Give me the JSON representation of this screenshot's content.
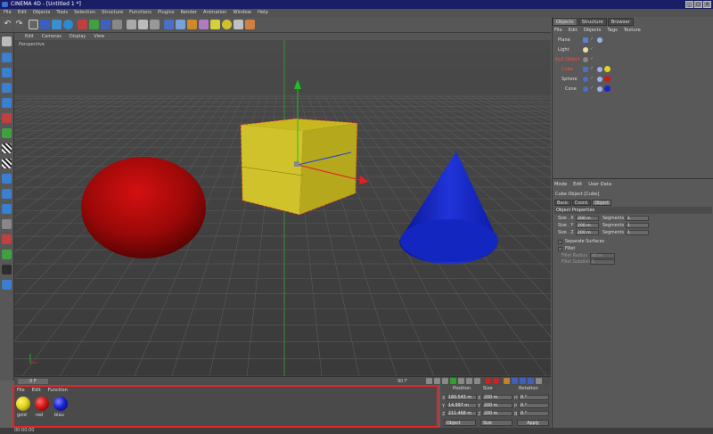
{
  "window": {
    "title": "CINEMA 4D - [Untitled 1 *]",
    "buttons": [
      "_",
      "□",
      "×"
    ]
  },
  "menu": [
    "File",
    "Edit",
    "Objects",
    "Tools",
    "Selection",
    "Structure",
    "Functions",
    "Plugins",
    "Render",
    "Animation",
    "Window",
    "Help"
  ],
  "viewport": {
    "menu": [
      "Edit",
      "Cameras",
      "Display",
      "View"
    ],
    "label": "Perspective",
    "objects": [
      {
        "name": "Sphere",
        "color": "#c81010"
      },
      {
        "name": "Cube",
        "color": "#d6c62a"
      },
      {
        "name": "Cone",
        "color": "#1a2fc8"
      }
    ]
  },
  "timeline": {
    "frame": "0 F",
    "end_frame": "90 F"
  },
  "material_manager": {
    "menu": [
      "File",
      "Edit",
      "Function"
    ],
    "materials": [
      {
        "name": "gold",
        "color": "#e3d21e"
      },
      {
        "name": "red",
        "color": "#d01818"
      },
      {
        "name": "blau",
        "color": "#1824d0"
      }
    ],
    "highlight_color": "#e8222a"
  },
  "coordinates": {
    "headers": {
      "position": "Position",
      "size": "Size",
      "rotation": "Rotation"
    },
    "rows": [
      {
        "axis": "X",
        "position": "180.543 m",
        "size": "200 m",
        "rot_axis": "H",
        "rotation": "0 °"
      },
      {
        "axis": "Y",
        "position": "14.997 m",
        "size": "200 m",
        "rot_axis": "P",
        "rotation": "0 °"
      },
      {
        "axis": "Z",
        "position": "211.468 m",
        "size": "200 m",
        "rot_axis": "B",
        "rotation": "0 °"
      }
    ],
    "dropdown_left": "Object",
    "dropdown_mid": "Size",
    "apply_label": "Apply"
  },
  "status": {
    "text": "00:00:00"
  },
  "objects_panel": {
    "tabs": [
      "Objects",
      "Structure",
      "Browser"
    ],
    "menu": [
      "File",
      "Edit",
      "Objects",
      "Tags",
      "Texture"
    ],
    "items": [
      {
        "name": "Plane",
        "indent": 0,
        "selected": false,
        "material_color": null
      },
      {
        "name": "Light",
        "indent": 0,
        "selected": false,
        "material_color": null
      },
      {
        "name": "Null Object",
        "indent": 0,
        "selected": true,
        "material_color": null
      },
      {
        "name": "Cube",
        "indent": 1,
        "selected": true,
        "material_color": "#e3d21e"
      },
      {
        "name": "Sphere",
        "indent": 1,
        "selected": false,
        "material_color": "#d01818"
      },
      {
        "name": "Cone",
        "indent": 1,
        "selected": false,
        "material_color": "#1824d0"
      }
    ]
  },
  "attributes": {
    "menu": [
      "Mode",
      "Edit",
      "User Data"
    ],
    "title": "Cube Object [Cube]",
    "tabs": [
      "Basic",
      "Coord.",
      "Object"
    ],
    "active_tab": "Object",
    "section_header": "Object Properties",
    "size_rows": [
      {
        "label": "Size . X",
        "value": "200 m",
        "seg_label": "Segments X",
        "seg_value": "1"
      },
      {
        "label": "Size . Y",
        "value": "200 m",
        "seg_label": "Segments Y",
        "seg_value": "1"
      },
      {
        "label": "Size . Z",
        "value": "200 m",
        "seg_label": "Segments Z",
        "seg_value": "1"
      }
    ],
    "separate_surfaces": "Separate Surfaces",
    "fillet": "Fillet",
    "fillet_radius": {
      "label": "Fillet Radius",
      "value": "40 m"
    },
    "fillet_subdivision": {
      "label": "Fillet Subdivision",
      "value": "5"
    }
  },
  "colors": {
    "accent_red": "#e8222a",
    "window_title_bg": "#1a1e66"
  }
}
